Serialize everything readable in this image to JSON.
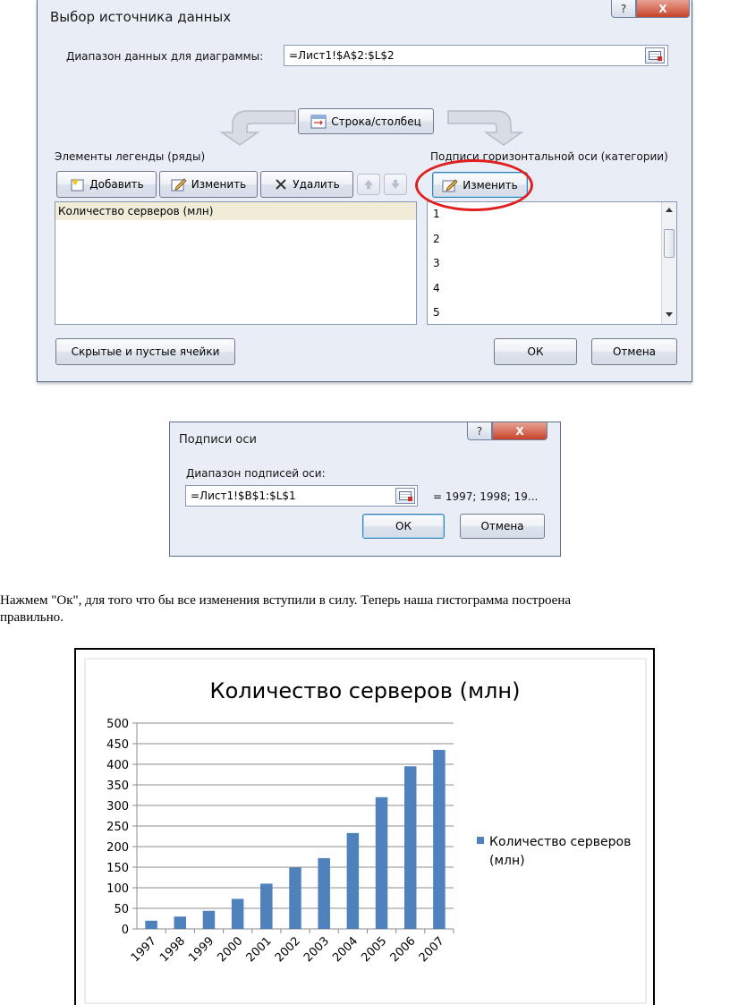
{
  "dialog1": {
    "title": "Выбор источника данных",
    "help_label": "?",
    "close_label": "X",
    "range_label": "Диапазон данных для диаграммы:",
    "range_value": "=Лист1!$A$2:$L$2",
    "switch_button": "Строка/столбец",
    "legend_title": "Элементы легенды (ряды)",
    "axis_title": "Подписи горизонтальной оси (категории)",
    "add_button": "Добавить",
    "edit_button": "Изменить",
    "delete_button": "Удалить",
    "series_items": [
      "Количество серверов (млн)"
    ],
    "axis_edit_button": "Изменить",
    "axis_items": [
      "1",
      "2",
      "3",
      "4",
      "5"
    ],
    "hidden_cells_button": "Скрытые и пустые ячейки",
    "ok_button": "ОК",
    "cancel_button": "Отмена"
  },
  "dialog2": {
    "title": "Подписи оси",
    "help_label": "?",
    "close_label": "X",
    "range_label": "Диапазон подписей оси:",
    "range_value": "=Лист1!$B$1:$L$1",
    "preview": "= 1997; 1998; 19...",
    "ok_button": "ОК",
    "cancel_button": "Отмена"
  },
  "paragraph": {
    "line1": "Нажмем \"Ок\", для того что бы все изменения вступили в силу. Теперь наша гистограмма построена",
    "line2": "правильно."
  },
  "colors": {
    "bar": "#4f81bd",
    "highlight_ring": "#e02020"
  },
  "chart_data": {
    "type": "bar",
    "title": "Количество серверов (млн)",
    "categories": [
      "1997",
      "1998",
      "1999",
      "2000",
      "2001",
      "2002",
      "2003",
      "2004",
      "2005",
      "2006",
      "2007"
    ],
    "series": [
      {
        "name": "Количество серверов (млн)",
        "values": [
          20,
          30,
          44,
          73,
          110,
          149,
          172,
          233,
          320,
          395,
          435
        ]
      }
    ],
    "ylim": [
      0,
      500
    ],
    "yticks": [
      0,
      50,
      100,
      150,
      200,
      250,
      300,
      350,
      400,
      450,
      500
    ],
    "grid": true,
    "legend": "right"
  }
}
